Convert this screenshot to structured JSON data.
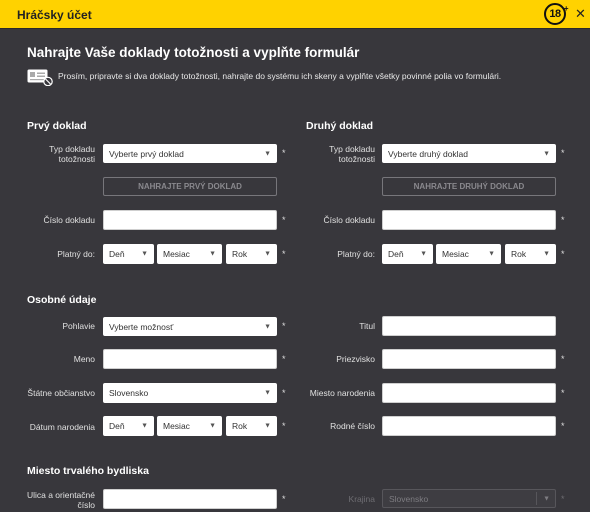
{
  "header": {
    "title": "Hráčsky účet",
    "age_badge": "18",
    "age_plus": "+",
    "close_glyph": "✕"
  },
  "main_title": "Nahrajte Vaše doklady totožnosti a vyplňte formulár",
  "info_text": "Prosím, pripravte si dva doklady totožnosti, nahrajte do systému ich skeny a vyplňte všetky povinné polia vo formulári.",
  "required_mark": "*",
  "first_doc": {
    "title": "Prvý doklad",
    "type_label": "Typ dokladu totožnosti",
    "type_value": "Vyberte prvý doklad",
    "upload_label": "NAHRAJTE PRVÝ DOKLAD",
    "number_label": "Číslo dokladu",
    "valid_label": "Platný do:",
    "day": "Deň",
    "month": "Mesiac",
    "year": "Rok"
  },
  "second_doc": {
    "title": "Druhý doklad",
    "type_label": "Typ dokladu totožnosti",
    "type_value": "Vyberte druhý doklad",
    "upload_label": "NAHRAJTE DRUHÝ DOKLAD",
    "number_label": "Číslo dokladu",
    "valid_label": "Platný do:",
    "day": "Deň",
    "month": "Mesiac",
    "year": "Rok"
  },
  "personal": {
    "title": "Osobné údaje",
    "gender_label": "Pohlavie",
    "gender_value": "Vyberte možnosť",
    "title_label": "Titul",
    "name_label": "Meno",
    "surname_label": "Priezvisko",
    "citizenship_label": "Štátne občianstvo",
    "citizenship_value": "Slovensko",
    "birthplace_label": "Miesto narodenia",
    "birthdate_label": "Dátum narodenia",
    "day": "Deň",
    "month": "Mesiac",
    "year": "Rok",
    "birth_number_label": "Rodné číslo"
  },
  "residence": {
    "title": "Miesto trvalého bydliska",
    "street_label": "Ulica a orientačné číslo",
    "country_label": "Krajina",
    "country_value": "Slovensko"
  },
  "colors": {
    "accent": "#ffd200",
    "background": "#38373c"
  },
  "icons": {
    "caret": "▼",
    "id_card": "id-card-icon"
  }
}
